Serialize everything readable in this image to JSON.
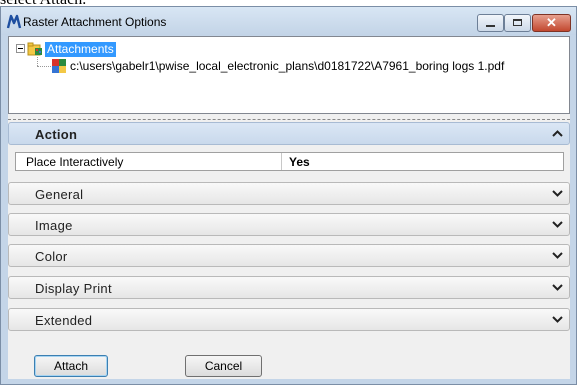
{
  "caption": "select Attach.",
  "window": {
    "title": "Raster Attachment Options",
    "close_glyph": "✕"
  },
  "tree": {
    "root_label": "Attachments",
    "child_label": "c:\\users\\gabelr1\\pwise_local_electronic_plans\\d0181722\\A7961_boring logs 1.pdf"
  },
  "sections": {
    "action": "Action",
    "general": "General",
    "image": "Image",
    "color": "Color",
    "display_print": "Display Print",
    "extended": "Extended"
  },
  "property": {
    "name": "Place Interactively",
    "value": "Yes"
  },
  "buttons": {
    "attach": "Attach",
    "cancel": "Cancel"
  },
  "colors": {
    "selection": "#3399ff",
    "window_frame": "#c4d5e8",
    "close_button": "#c2482f"
  },
  "icons": {
    "app": "microstation-icon",
    "root": "attachments-folder-icon",
    "file": "raster-file-icon",
    "chevrons": [
      "chevron-up-icon",
      "chevron-down-icon"
    ]
  }
}
